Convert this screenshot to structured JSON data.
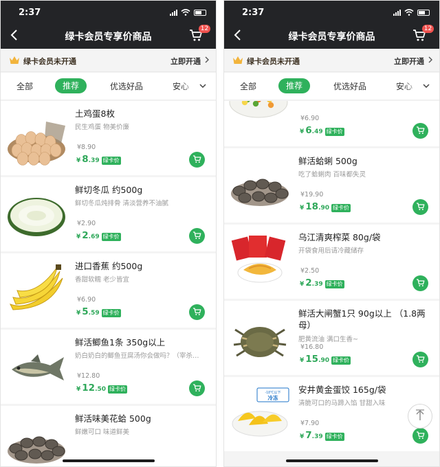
{
  "status": {
    "time": "2:37"
  },
  "header": {
    "title": "绿卡会员专享价商品",
    "cart_count": "12"
  },
  "member_bar": {
    "text": "绿卡会员未开通",
    "action": "立即开通"
  },
  "tabs": {
    "items": [
      {
        "label": "全部"
      },
      {
        "label": "推荐"
      },
      {
        "label": "优选好品"
      },
      {
        "label": "安心"
      }
    ],
    "active_index": 1
  },
  "left": {
    "products": [
      {
        "name": "土鸡蛋8枚",
        "desc": "民生鸡蛋 物美价廉",
        "orig": "¥8.90",
        "int": "8",
        "dec": ".39",
        "image": "eggs"
      },
      {
        "name": "鲜切冬瓜 约500g",
        "desc": "鲜切冬瓜炖排骨 清淡营养不油腻",
        "orig": "¥2.90",
        "int": "2",
        "dec": ".69",
        "image": "winter-melon"
      },
      {
        "name": "进口香蕉 约500g",
        "desc": "香甜软糯 老少皆宜",
        "orig": "¥6.90",
        "int": "5",
        "dec": ".59",
        "image": "bananas"
      },
      {
        "name": "鲜活鲫鱼1条 350g以上",
        "desc": "奶白奶白的鲫鱼豆腐汤你会做吗？（宰杀…",
        "orig": "¥12.80",
        "int": "12",
        "dec": ".50",
        "image": "crucian-fish"
      },
      {
        "name": "鲜活味美花蛤 500g",
        "desc": "鲜嫩可口 味道鲜美",
        "orig": "",
        "int": "",
        "dec": "",
        "image": "clams"
      }
    ]
  },
  "right": {
    "products": [
      {
        "name": "",
        "desc": "",
        "orig": "¥6.90",
        "int": "6",
        "dec": ".49",
        "image": "mixed-vegetables"
      },
      {
        "name": "鲜活蛤蜊 500g",
        "desc": "吃了蛤蜊肉 百味都失灵",
        "orig": "¥19.90",
        "int": "18",
        "dec": ".90",
        "image": "clams"
      },
      {
        "name": "乌江清爽榨菜 80g/袋",
        "desc": "开袋食用后请冷藏储存",
        "orig": "¥2.50",
        "int": "2",
        "dec": ".39",
        "image": "pickled-mustard"
      },
      {
        "name": "鲜活大闸蟹1只 90g以上 （1.8两母）",
        "desc": "肥黄流油 满口生香~",
        "orig": "¥16.80",
        "int": "15",
        "dec": ".90",
        "image": "hairy-crab"
      },
      {
        "name": "安井黄金蛋饺 165g/袋",
        "desc": "清脆可口的马蹄入馅 甘甜入味",
        "orig": "¥7.90",
        "int": "7",
        "dec": ".39",
        "image": "egg-dumplings",
        "badge": "-18℃以下 冷冻"
      }
    ]
  },
  "price_tag": "绿卡价",
  "colors": {
    "accent": "#2fb15c",
    "header": "#232427",
    "price": "#2fa85a"
  }
}
